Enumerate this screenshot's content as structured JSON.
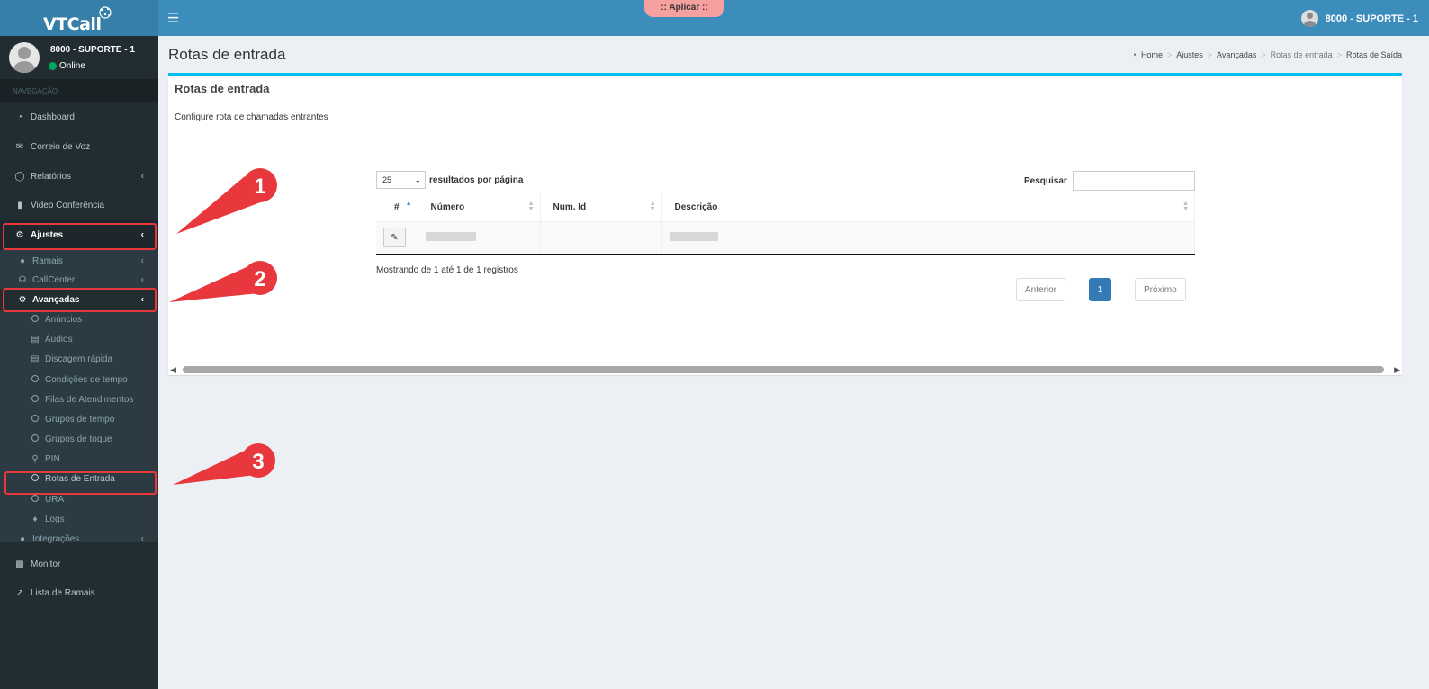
{
  "app": {
    "logo_text": "VTCall",
    "apply_label": ":: Aplicar ::"
  },
  "header": {
    "user_label": "8000 - SUPORTE - 1"
  },
  "sidebar": {
    "user_name": "8000 - SUPORTE - 1",
    "user_status": "Online",
    "nav_header": "NAVEGAÇÃO",
    "items": {
      "dashboard": "Dashboard",
      "voicemail": "Correio de Voz",
      "reports": "Relatórios",
      "video": "Video Conferência",
      "settings": "Ajustes",
      "monitor": "Monitor",
      "extensions_list": "Lista de Ramais"
    },
    "submenu": {
      "extensions": "Ramais",
      "callcenter": "CallCenter",
      "advanced": "Avançadas",
      "announcements": "Anúncios",
      "audios": "Áudios",
      "speed_dial": "Discagem rápida",
      "time_conditions": "Condições de tempo",
      "queues": "Filas de Atendimentos",
      "time_groups": "Grupos de tempo",
      "ring_groups": "Grupos de toque",
      "pin": "PIN",
      "inbound_routes": "Rotas de Entrada",
      "ivr": "URA",
      "logs": "Logs",
      "integrations": "Integrações"
    }
  },
  "page": {
    "title": "Rotas de entrada",
    "breadcrumb": [
      "Home",
      "Ajustes",
      "Avançadas",
      "Rotas de entrada",
      "Rotas de Saída"
    ]
  },
  "box": {
    "title": "Rotas de entrada",
    "description": "Configure rota de chamadas entrantes"
  },
  "datatable": {
    "page_length": "25",
    "length_label": "resultados por página",
    "search_label": "Pesquisar",
    "columns": [
      "#",
      "Número",
      "Num. Id",
      "Descrição"
    ],
    "info": "Mostrando de 1 até 1 de 1 registros",
    "pagination": {
      "prev": "Anterior",
      "current": "1",
      "next": "Próximo"
    }
  },
  "annotations": [
    "1",
    "2",
    "3"
  ],
  "colors": {
    "header": "#3c8dbc",
    "sidebar": "#222d32",
    "highlight": "#e8383d",
    "box_accent": "#00c0ef"
  }
}
